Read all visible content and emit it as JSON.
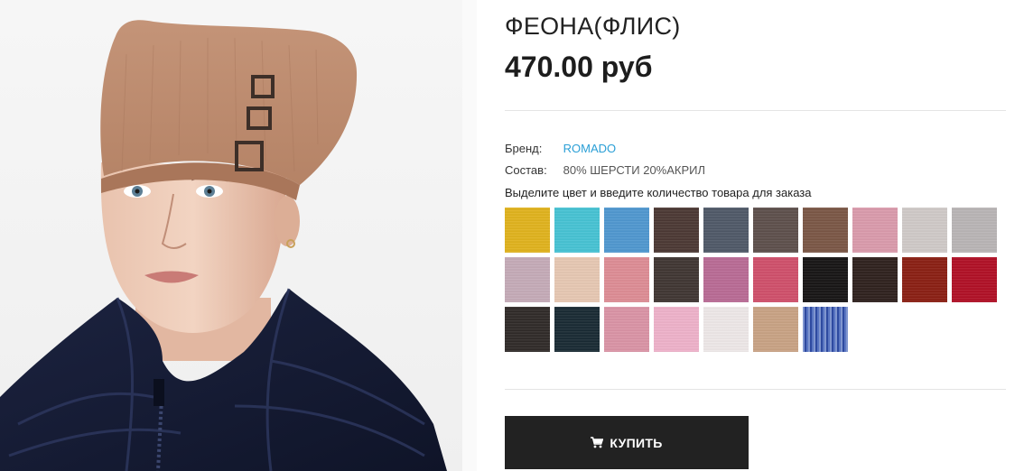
{
  "product": {
    "title": "ФЕОНА(ФЛИС)",
    "price": "470.00 руб"
  },
  "details": {
    "brand_label": "Бренд:",
    "brand_value": "ROMADO",
    "composition_label": "Состав:",
    "composition_value": "80% ШЕРСТИ 20%АКРИЛ",
    "instruction": "Выделите цвет и введите количество товара для заказа"
  },
  "swatches": [
    "#e0b21c",
    "#46c2d3",
    "#4f97cf",
    "#4b3833",
    "#4f5867",
    "#5d4f4b",
    "#7a5645",
    "#d99aab",
    "#cfc9c7",
    "#b8b4b5",
    "#c4aab7",
    "#e6c7b2",
    "#dd8c94",
    "#3f3532",
    "#b86a94",
    "#cf4f6a",
    "#161414",
    "#2e201d",
    "#8a1e12",
    "#b00f25",
    "#2f2a28",
    "#192a33",
    "#d993a5",
    "#eeb1c9",
    "#ede7e7",
    "#c8a283",
    "#3c5db6"
  ],
  "actions": {
    "buy_label": "КУПИТЬ"
  },
  "icons": {
    "cart": "cart-icon"
  }
}
